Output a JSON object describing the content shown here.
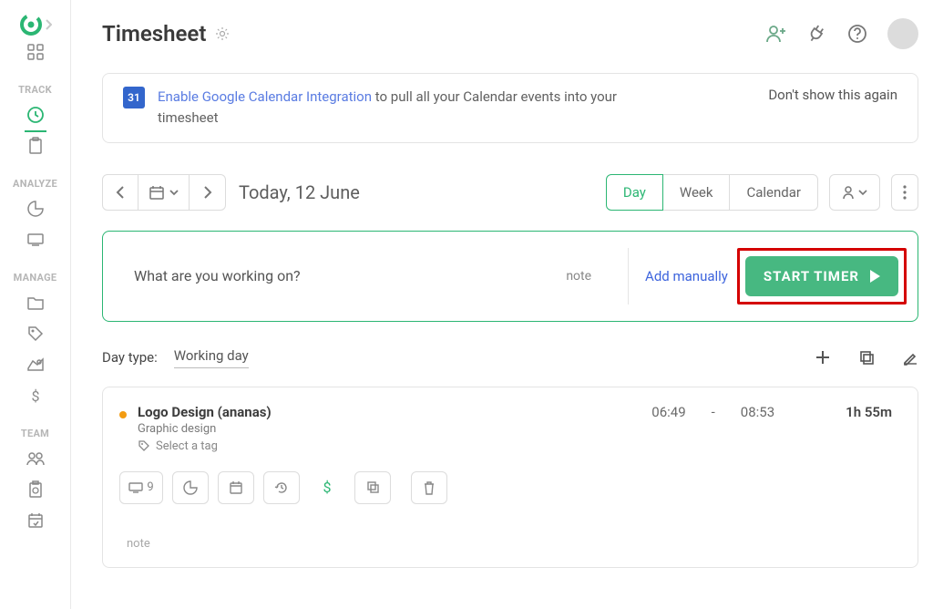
{
  "page_title": "Timesheet",
  "banner": {
    "icon_text": "31",
    "link_text": "Enable Google Calendar Integration",
    "rest_text": " to pull all your Calendar events into your timesheet",
    "dismiss": "Don't show this again"
  },
  "date": {
    "label": "Today, 12 June"
  },
  "views": {
    "day": "Day",
    "week": "Week",
    "calendar": "Calendar"
  },
  "timer": {
    "placeholder": "What are you working on?",
    "note": "note",
    "add_manual": "Add manually",
    "start": "START TIMER"
  },
  "day": {
    "label": "Day type:",
    "value": "Working day"
  },
  "entry": {
    "title": "Logo Design (ananas)",
    "subtitle": "Graphic design",
    "tag": "Select a tag",
    "start": "06:49",
    "sep": "-",
    "end": "08:53",
    "duration": "1h 55m",
    "apps_count": "9",
    "note": "note"
  },
  "sidebar": {
    "track": "TRACK",
    "analyze": "ANALYZE",
    "manage": "MANAGE",
    "team": "TEAM"
  }
}
